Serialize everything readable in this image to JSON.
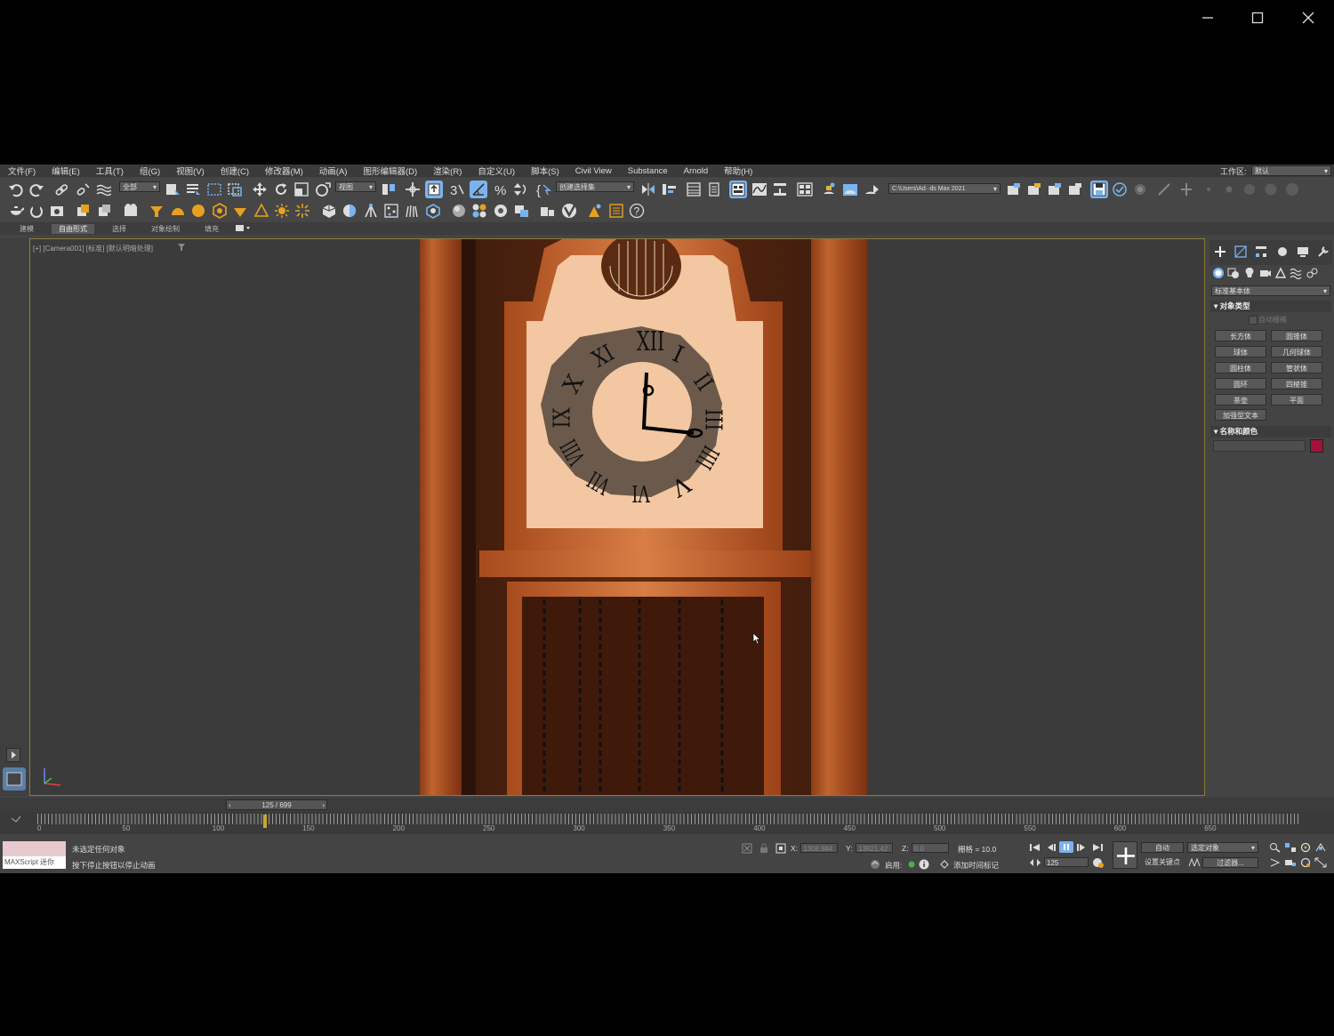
{
  "window": {
    "minimize": "—",
    "maximize": "☐",
    "close": "✕"
  },
  "menu": [
    "文件(F)",
    "编辑(E)",
    "工具(T)",
    "组(G)",
    "视图(V)",
    "创建(C)",
    "修改器(M)",
    "动画(A)",
    "图形编辑器(D)",
    "渲染(R)",
    "自定义(U)",
    "脚本(S)",
    "Civil View",
    "Substance",
    "Arnold",
    "帮助(H)"
  ],
  "workspace": {
    "label": "工作区:",
    "value": "默认"
  },
  "toolbar": {
    "selection_filter": "全部",
    "ref_coord": "视图",
    "named_selection": "创建选择集",
    "project_path": "C:\\Users\\Ad··ds Max 2021"
  },
  "ribbon_tabs": [
    "建模",
    "自由形式",
    "选择",
    "对象绘制",
    "填充"
  ],
  "viewport": {
    "label": "[+] [Camera001] [标准] [默认明暗处理]",
    "clock_numerals": [
      "XII",
      "I",
      "II",
      "III",
      "IIII",
      "V",
      "VI",
      "VII",
      "VIII",
      "IX",
      "X",
      "XI"
    ]
  },
  "command_panel": {
    "category": "标准基本体",
    "object_type_header": "对象类型",
    "autogrid": "自动栅格",
    "buttons": [
      "长方体",
      "圆锥体",
      "球体",
      "几何球体",
      "圆柱体",
      "管状体",
      "圆环",
      "四棱锥",
      "茶壶",
      "平面",
      "加强型文本"
    ],
    "name_color_header": "名称和颜色",
    "object_color": "#a0123a"
  },
  "timeline": {
    "frame_display": "125 / 699",
    "current_frame": 125,
    "total_frames": 699,
    "ticks": [
      "0",
      "50",
      "100",
      "150",
      "200",
      "250",
      "300",
      "350",
      "400",
      "450",
      "500",
      "550",
      "600",
      "650"
    ]
  },
  "status": {
    "maxscript": "MAXScript 迷你",
    "line1": "未选定任何对象",
    "line2": "按下停止按钮以停止动画",
    "x_label": "X:",
    "x_value": "1308.984",
    "y_label": "Y:",
    "y_value": "13821.42",
    "z_label": "Z:",
    "z_value": "0.0",
    "grid": "栅格 = 10.0",
    "enable": "启用:",
    "add_time_tag": "添加时间标记",
    "auto_key": "自动",
    "selected_obj": "选定对象",
    "set_key": "设置关键点",
    "filters": "过滤器...",
    "frame_field": "125"
  }
}
